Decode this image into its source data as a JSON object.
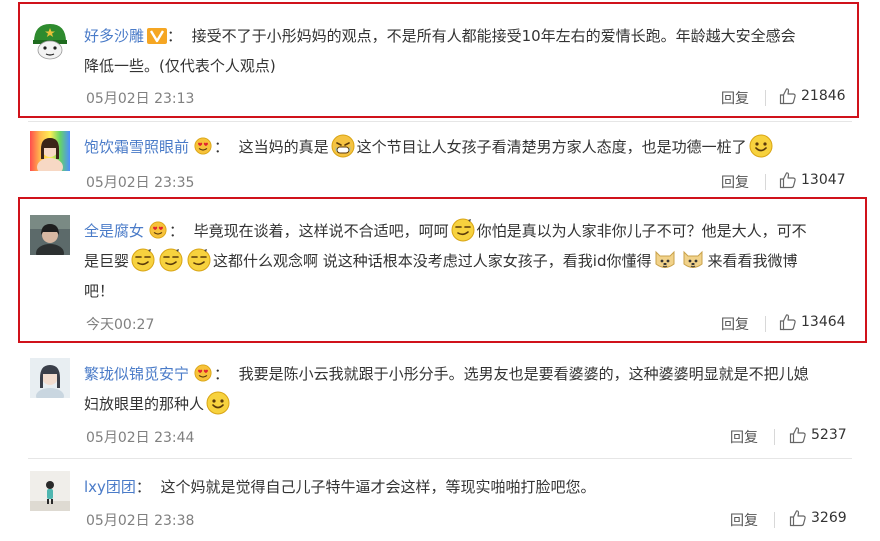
{
  "comments": [
    {
      "username": "好多沙雕",
      "badge": "vip-v-icon",
      "lines": [
        "接受不了于小彤妈妈的观点，不是所有人都能接受10年左右的爱情长跑。年龄越大安全感会",
        "降低一些。(仅代表个人观点)"
      ],
      "time": "05月02日 23:13",
      "reply": "回复",
      "likes": "21846"
    },
    {
      "username": "饱饮霜雪照眼前",
      "badge": "heart-eyes-icon",
      "text_a": "这当妈的真是",
      "text_b": "这个节目让人女孩子看清楚男方家人态度，也是功德一桩了",
      "time": "05月02日 23:35",
      "reply": "回复",
      "likes": "13047"
    },
    {
      "username": "全是腐女",
      "badge": "heart-eyes-icon",
      "line1_a": "毕竟现在谈着，这样说不合适吧，呵呵",
      "line1_b": "你怕是真以为人家非你儿子不可？他是大人，可不",
      "line2_a": "是巨婴",
      "line2_b": "这都什么观念啊 说这种话根本没考虑过人家女孩子，看我id你懂得",
      "line2_c": "来看看我微博",
      "line3": "吧！",
      "time": "今天00:27",
      "reply": "回复",
      "likes": "13464"
    },
    {
      "username": "繁珑似锦觅安宁",
      "badge": "heart-eyes-icon",
      "line1": "我要是陈小云我就跟于小彤分手。选男友也是要看婆婆的，这种婆婆明显就是不把儿媳",
      "line2": "妇放眼里的那种人",
      "time": "05月02日 23:44",
      "reply": "回复",
      "likes": "5237"
    },
    {
      "username": "lxy团团",
      "text": "这个妈就是觉得自己儿子特牛逼才会这样，等现实啪啪打脸吧您。",
      "time": "05月02日 23:38",
      "reply": "回复",
      "likes": "3269"
    }
  ],
  "colors": {
    "username": "#4a7bc8",
    "highlight_border": "#d0121b",
    "time": "#808080"
  }
}
